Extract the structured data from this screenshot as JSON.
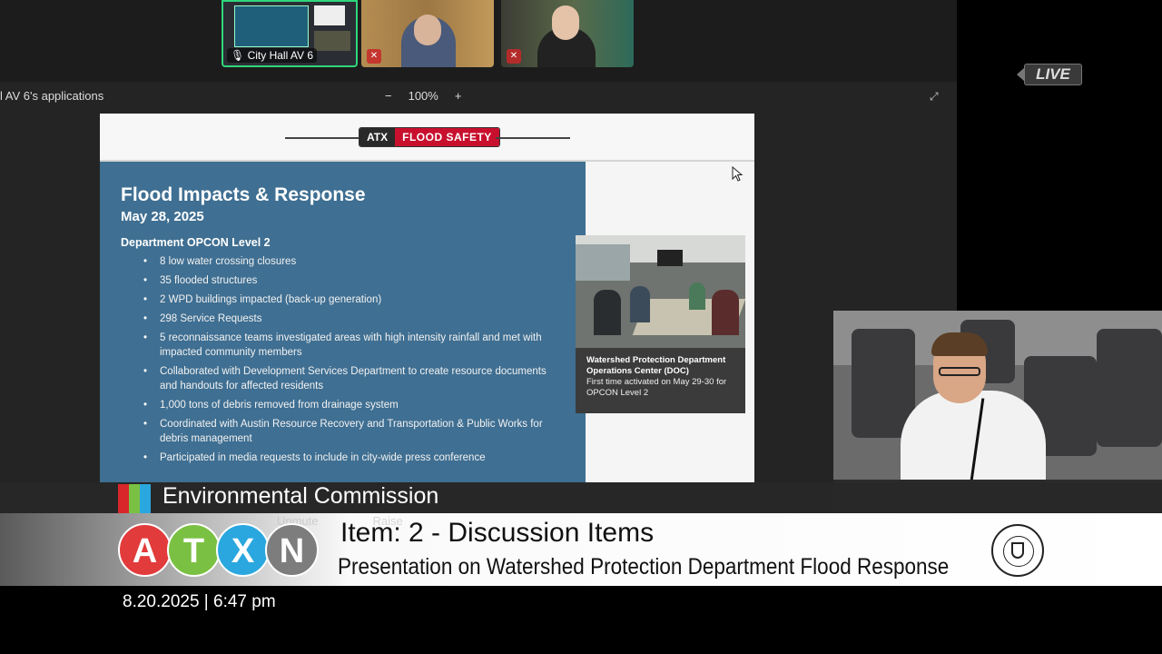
{
  "meeting": {
    "participants": [
      {
        "name": "City Hall AV 6"
      },
      {
        "name": ""
      },
      {
        "name": ""
      }
    ],
    "share_label": "l AV 6's applications",
    "zoom": {
      "minus": "−",
      "level": "100%",
      "plus": "+"
    },
    "live": "LIVE"
  },
  "slide": {
    "header": {
      "atx": "ATX",
      "brand": "FLOOD SAFETY"
    },
    "title": "Flood Impacts & Response",
    "date": "May 28, 2025",
    "subtitle": "Department OPCON Level 2",
    "bullets": [
      "8 low water crossing closures",
      "35 flooded structures",
      "2 WPD buildings impacted (back-up generation)",
      "298 Service Requests",
      "5 reconnaissance teams investigated areas with high intensity rainfall and met with impacted community members",
      "Collaborated with Development Services Department to create resource documents and handouts for affected residents",
      "1,000 tons of debris removed from drainage system",
      "Coordinated with Austin Resource Recovery and Transportation & Public Works for debris management",
      "Participated in media requests to include in city-wide press conference"
    ],
    "caption": {
      "title": "Watershed Protection Department Operations Center (DOC)",
      "text": "First time activated on May 29-30 for OPCON Level 2"
    }
  },
  "broadcast": {
    "commission": "Environmental Commission",
    "ghost_buttons": [
      "Unmute",
      "Raise"
    ],
    "logo_letters": [
      "A",
      "T",
      "X",
      "N"
    ],
    "logo_colors": [
      "#e23b3b",
      "#7ac143",
      "#2aa7df",
      "#7d7d7d"
    ],
    "item": "Item: 2 - Discussion Items",
    "presentation": "Presentation on Watershed Protection Department Flood Response",
    "timestamp": "8.20.2025 | 6:47 pm"
  },
  "colors": {
    "slide_blue": "#3f6f92",
    "brand_red": "#c8102e",
    "active_border": "#2fd67c",
    "strip": [
      "#d8262b",
      "#7ac143",
      "#2aa7df"
    ]
  }
}
